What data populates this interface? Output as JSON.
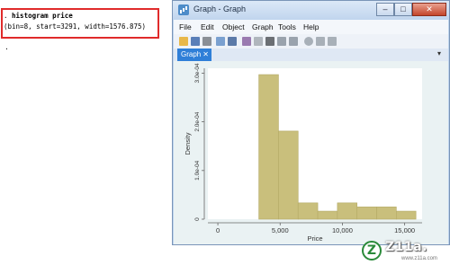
{
  "results": {
    "command_prefix": ". ",
    "command": "histogram price",
    "output": "(bin=8, start=3291, width=1576.875)",
    "prompt": "."
  },
  "window": {
    "title": "Graph - Graph",
    "minimize": "–",
    "maximize": "□",
    "close": "✕"
  },
  "menu": [
    "File",
    "Edit",
    "Object",
    "Graph",
    "Tools",
    "Help"
  ],
  "tab": {
    "label": "Graph",
    "close": "✕",
    "chevron": "▾"
  },
  "colors": {
    "bar": "#c9bf7c",
    "bar_edge": "#b4aa66",
    "plot_bg": "#eaf2f3",
    "frame_bg": "#ffffff",
    "accent": "#2f7fd8"
  },
  "chart_data": {
    "type": "bar",
    "title": "",
    "xlabel": "Price",
    "ylabel": "Density",
    "xlim": [
      -800,
      16400
    ],
    "ylim": [
      0,
      0.00031
    ],
    "bin_start": 3291,
    "bin_width": 1576.875,
    "values": [
      0.000297,
      0.000181,
      3.35e-05,
      1.65e-05,
      3.35e-05,
      2.52e-05,
      2.52e-05,
      1.65e-05
    ],
    "x_ticks": [
      0,
      5000,
      10000,
      15000
    ],
    "x_tick_labels": [
      "0",
      "5,000",
      "10,000",
      "15,000"
    ],
    "y_ticks": [
      0,
      0.0001,
      0.0002,
      0.0003
    ],
    "y_tick_labels": [
      "0",
      "1.0e-04",
      "2.0e-04",
      "3.0e-04"
    ],
    "grid": false
  },
  "watermark": {
    "text": "Z11a.",
    "url": "www.z11a.com"
  }
}
